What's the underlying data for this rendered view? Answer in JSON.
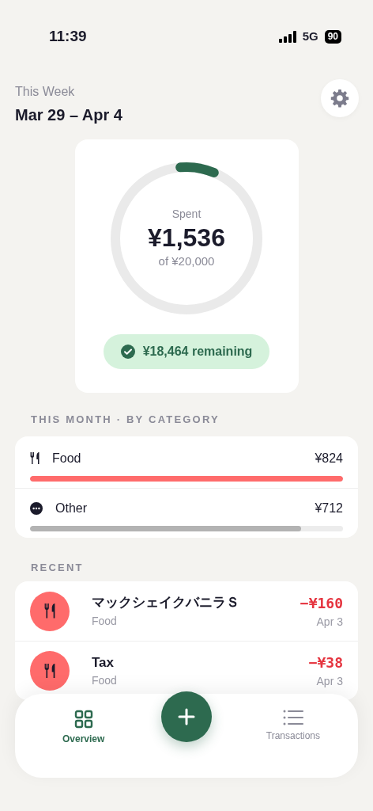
{
  "status_bar": {
    "time": "11:39",
    "network": "5G",
    "battery": "90"
  },
  "header": {
    "subtitle": "This Week",
    "title": "Mar 29 – Apr 4"
  },
  "budget": {
    "label": "Spent",
    "amount": "¥1,536",
    "of": "of ¥20,000",
    "level": 0.077,
    "remaining": "¥18,464 remaining"
  },
  "categories_heading": "THIS MONTH · BY CATEGORY",
  "categories": [
    {
      "kind": "food",
      "name": "Food",
      "amount": "¥824",
      "level": 1.0,
      "color": "#ff6b6b"
    },
    {
      "kind": "other",
      "name": "Other",
      "amount": "¥712",
      "level": 0.865,
      "color": "#b3b3b3"
    }
  ],
  "recent_heading": "RECENT",
  "transactions": [
    {
      "kind": "food",
      "title": "マックシェイクバニラＳ",
      "category": "Food",
      "amount": "−¥160",
      "date": "Apr 3"
    },
    {
      "kind": "food",
      "title": "Tax",
      "category": "Food",
      "amount": "−¥38",
      "date": "Apr 3"
    }
  ],
  "tabs": [
    {
      "kind": "overview",
      "label": "Overview",
      "selected": true
    },
    {
      "kind": "transactions",
      "label": "Transactions",
      "selected": false
    }
  ]
}
